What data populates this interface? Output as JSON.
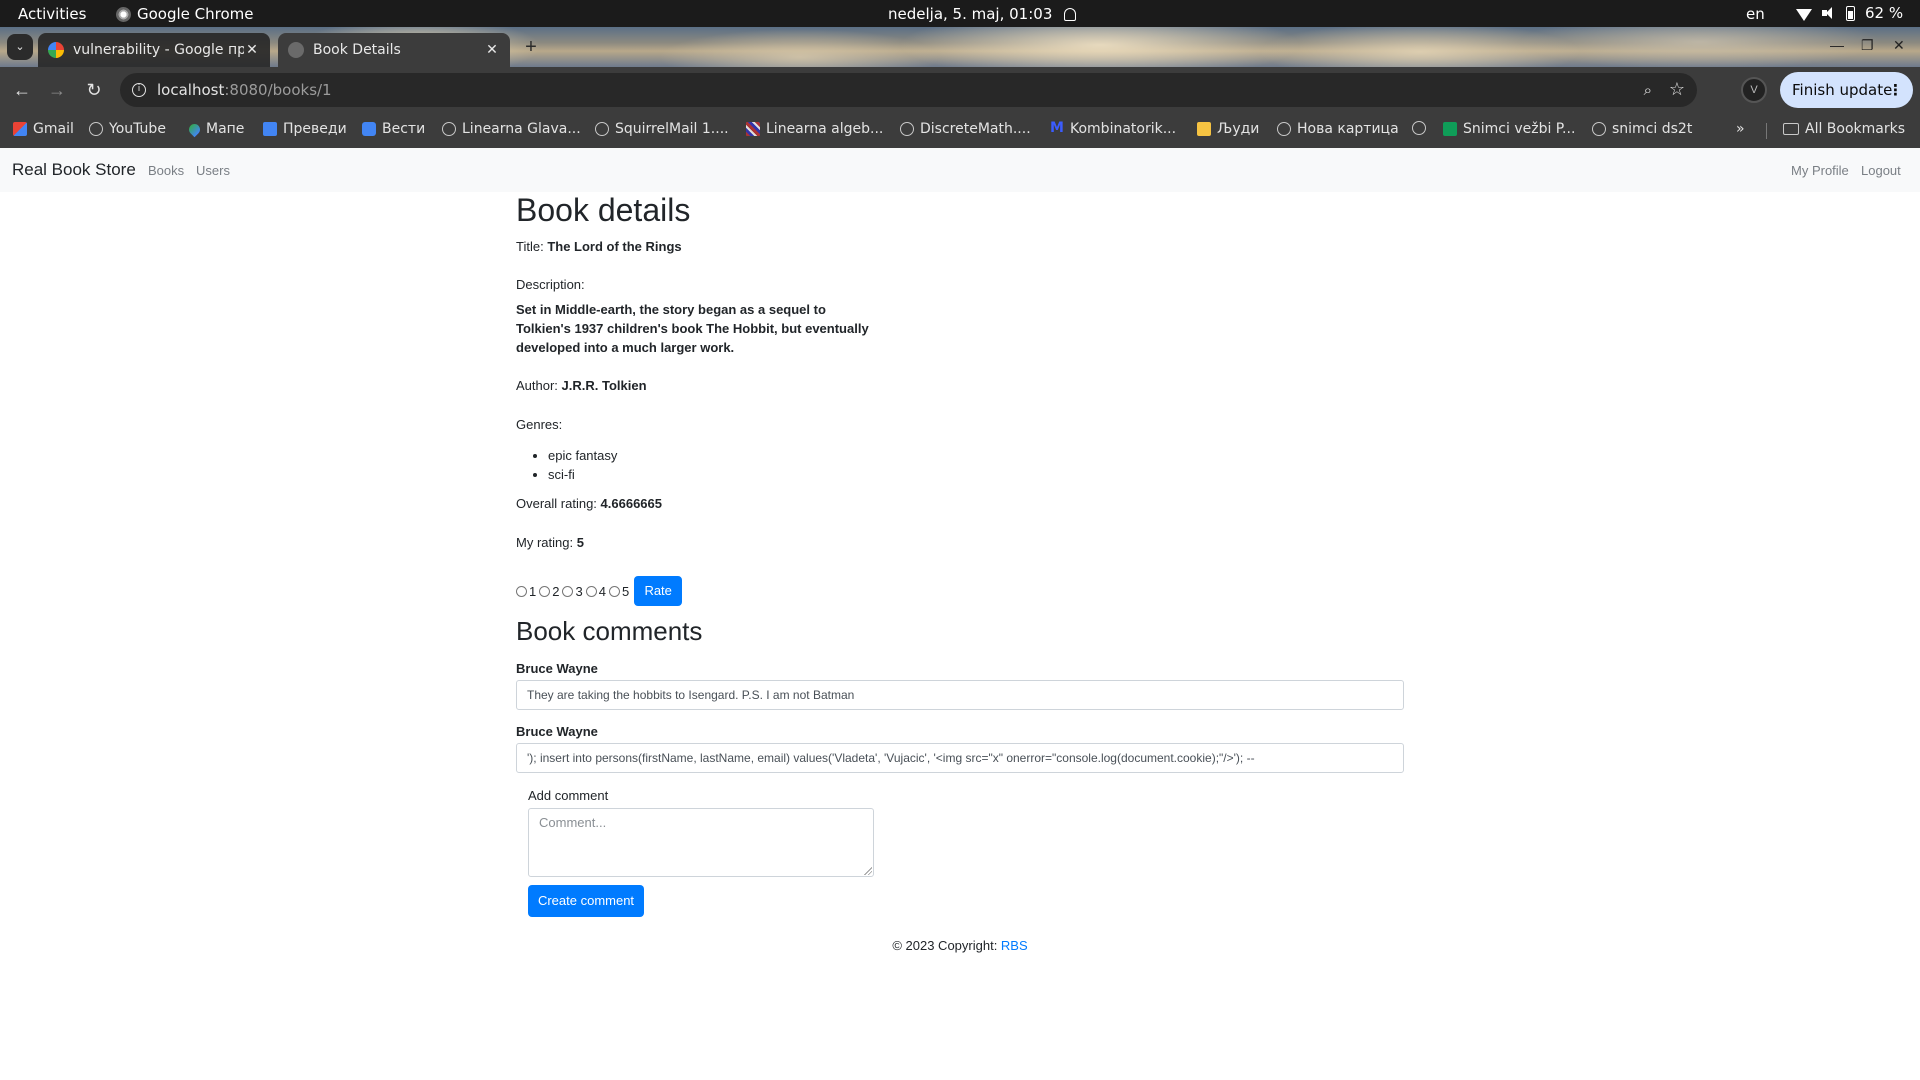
{
  "system_bar": {
    "activities": "Activities",
    "app_name": "Google Chrome",
    "clock": "nedelja,  5. maj, 01:03",
    "language": "en",
    "battery": "62 %"
  },
  "browser": {
    "tabs": [
      {
        "title": "vulnerability - Google пр",
        "active": false
      },
      {
        "title": "Book Details",
        "active": true
      }
    ],
    "url_host": "localhost",
    "url_path": ":8080/books/1",
    "update_button": "Finish update",
    "profile_initial": "V",
    "bookmarks": [
      {
        "label": "Gmail",
        "icon": "gmail-icon"
      },
      {
        "label": "YouTube",
        "icon": "globe-icon"
      },
      {
        "label": "Мапе",
        "icon": "maps-icon"
      },
      {
        "label": "Преведи",
        "icon": "translate-icon"
      },
      {
        "label": "Вести",
        "icon": "news-icon"
      },
      {
        "label": "Linearna Glava...",
        "icon": "globe-icon"
      },
      {
        "label": "SquirrelMail 1....",
        "icon": "globe-icon"
      },
      {
        "label": "Linearna algeb...",
        "icon": "plaid-icon"
      },
      {
        "label": "DiscreteMath....",
        "icon": "globe-icon"
      },
      {
        "label": "Kombinatorik...",
        "icon": "m-icon"
      },
      {
        "label": "Људи",
        "icon": "people-icon"
      },
      {
        "label": "Нова картица",
        "icon": "globe-icon"
      },
      {
        "label": "",
        "icon": "globe-icon"
      },
      {
        "label": "Snimci vežbi P...",
        "icon": "sheets-icon"
      },
      {
        "label": "snimci ds2t",
        "icon": "globe-icon"
      }
    ],
    "all_bookmarks": "All Bookmarks"
  },
  "navbar": {
    "brand": "Real Book Store",
    "links": [
      "Books",
      "Users"
    ],
    "right_links": [
      "My Profile",
      "Logout"
    ]
  },
  "book": {
    "heading": "Book details",
    "title_label": "Title: ",
    "title": "The Lord of the Rings",
    "description_label": "Description:",
    "description": "Set in Middle-earth, the story began as a sequel to Tolkien's 1937 children's book The Hobbit, but eventually developed into a much larger work.",
    "author_label": "Author: ",
    "author": "J.R.R. Tolkien",
    "genres_label": "Genres:",
    "genres": [
      "epic fantasy",
      "sci-fi"
    ],
    "overall_label": "Overall rating: ",
    "overall_rating": "4.6666665",
    "my_rating_label": "My rating: ",
    "my_rating": "5",
    "rating_options": [
      "1",
      "2",
      "3",
      "4",
      "5"
    ],
    "rate_button": "Rate"
  },
  "comments": {
    "heading": "Book comments",
    "items": [
      {
        "author": "Bruce Wayne",
        "text": "They are taking the hobbits to Isengard. P.S. I am not Batman"
      },
      {
        "author": "Bruce Wayne",
        "text": "'); insert into persons(firstName, lastName, email) values('Vladeta', 'Vujacic', '<img src=\"x\" onerror=\"console.log(document.cookie);\"/>'); --"
      }
    ],
    "add_label": "Add comment",
    "placeholder": "Comment...",
    "create_button": "Create comment"
  },
  "footer": {
    "text": "© 2023 Copyright: ",
    "link": "RBS"
  },
  "colors": {
    "primary": "#007bff",
    "navbar_bg": "#f8f9fa",
    "chrome_dark": "#3c3c3c",
    "update_pill": "#d3e3fd"
  }
}
